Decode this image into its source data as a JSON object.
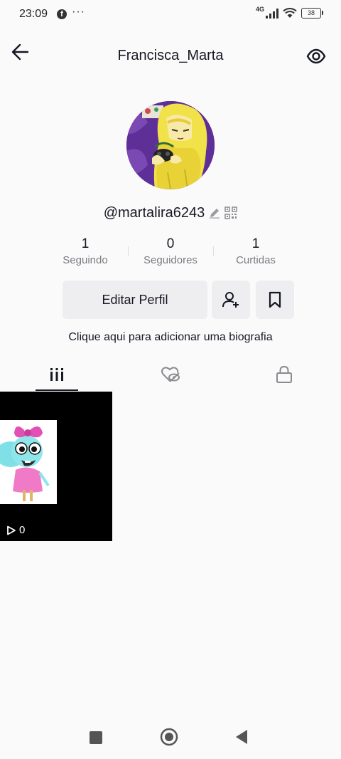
{
  "status_bar": {
    "time": "23:09",
    "facebook_glyph": "f",
    "more": "···",
    "network": "4G",
    "battery": "38"
  },
  "header": {
    "title": "Francisca_Marta"
  },
  "profile": {
    "username": "@martalira6243",
    "stats": [
      {
        "value": "1",
        "label": "Seguindo"
      },
      {
        "value": "0",
        "label": "Seguidores"
      },
      {
        "value": "1",
        "label": "Curtidas"
      }
    ],
    "edit_label": "Editar Perfil",
    "bio_prompt": "Clique aqui para adicionar uma biografia"
  },
  "tabs": [
    "videos-grid-icon",
    "liked-hidden-icon",
    "lock-icon"
  ],
  "videos": [
    {
      "views": "0"
    }
  ],
  "colors": {
    "background": "#fbfafb",
    "button_bg": "#eeeef0",
    "text_primary": "#161823",
    "text_secondary": "#7a7b80"
  }
}
